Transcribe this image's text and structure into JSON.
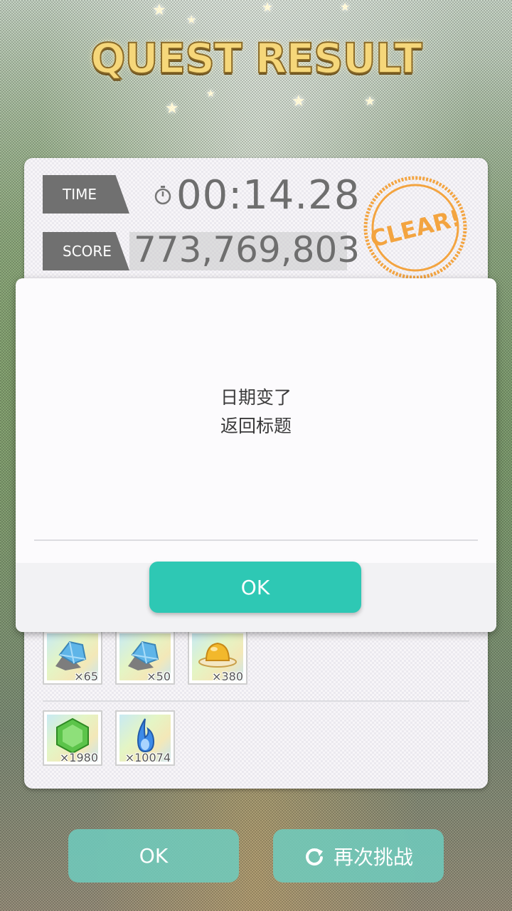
{
  "header": {
    "title": "QUEST RESULT"
  },
  "result": {
    "time_label": "TIME",
    "time_value": "00:14.28",
    "score_label": "SCORE",
    "score_value": "773,769,803",
    "stamp_text": "CLEAR!"
  },
  "rewards": {
    "row1": [
      {
        "icon": "blue-ore-icon",
        "qty": "×65"
      },
      {
        "icon": "blue-ore-icon",
        "qty": "×50"
      },
      {
        "icon": "gold-pudding-icon",
        "qty": "×380"
      }
    ],
    "row2": [
      {
        "icon": "green-gem-icon",
        "qty": "×1980"
      },
      {
        "icon": "blue-flame-icon",
        "qty": "×10074"
      }
    ]
  },
  "buttons": {
    "ok_label": "OK",
    "retry_label": "再次挑战"
  },
  "dialog": {
    "message_line1": "日期变了",
    "message_line2": "返回标题",
    "ok_label": "OK"
  },
  "colors": {
    "accent": "#2ec8b4",
    "stamp": "#f3a440",
    "title": "#f6d77a"
  }
}
